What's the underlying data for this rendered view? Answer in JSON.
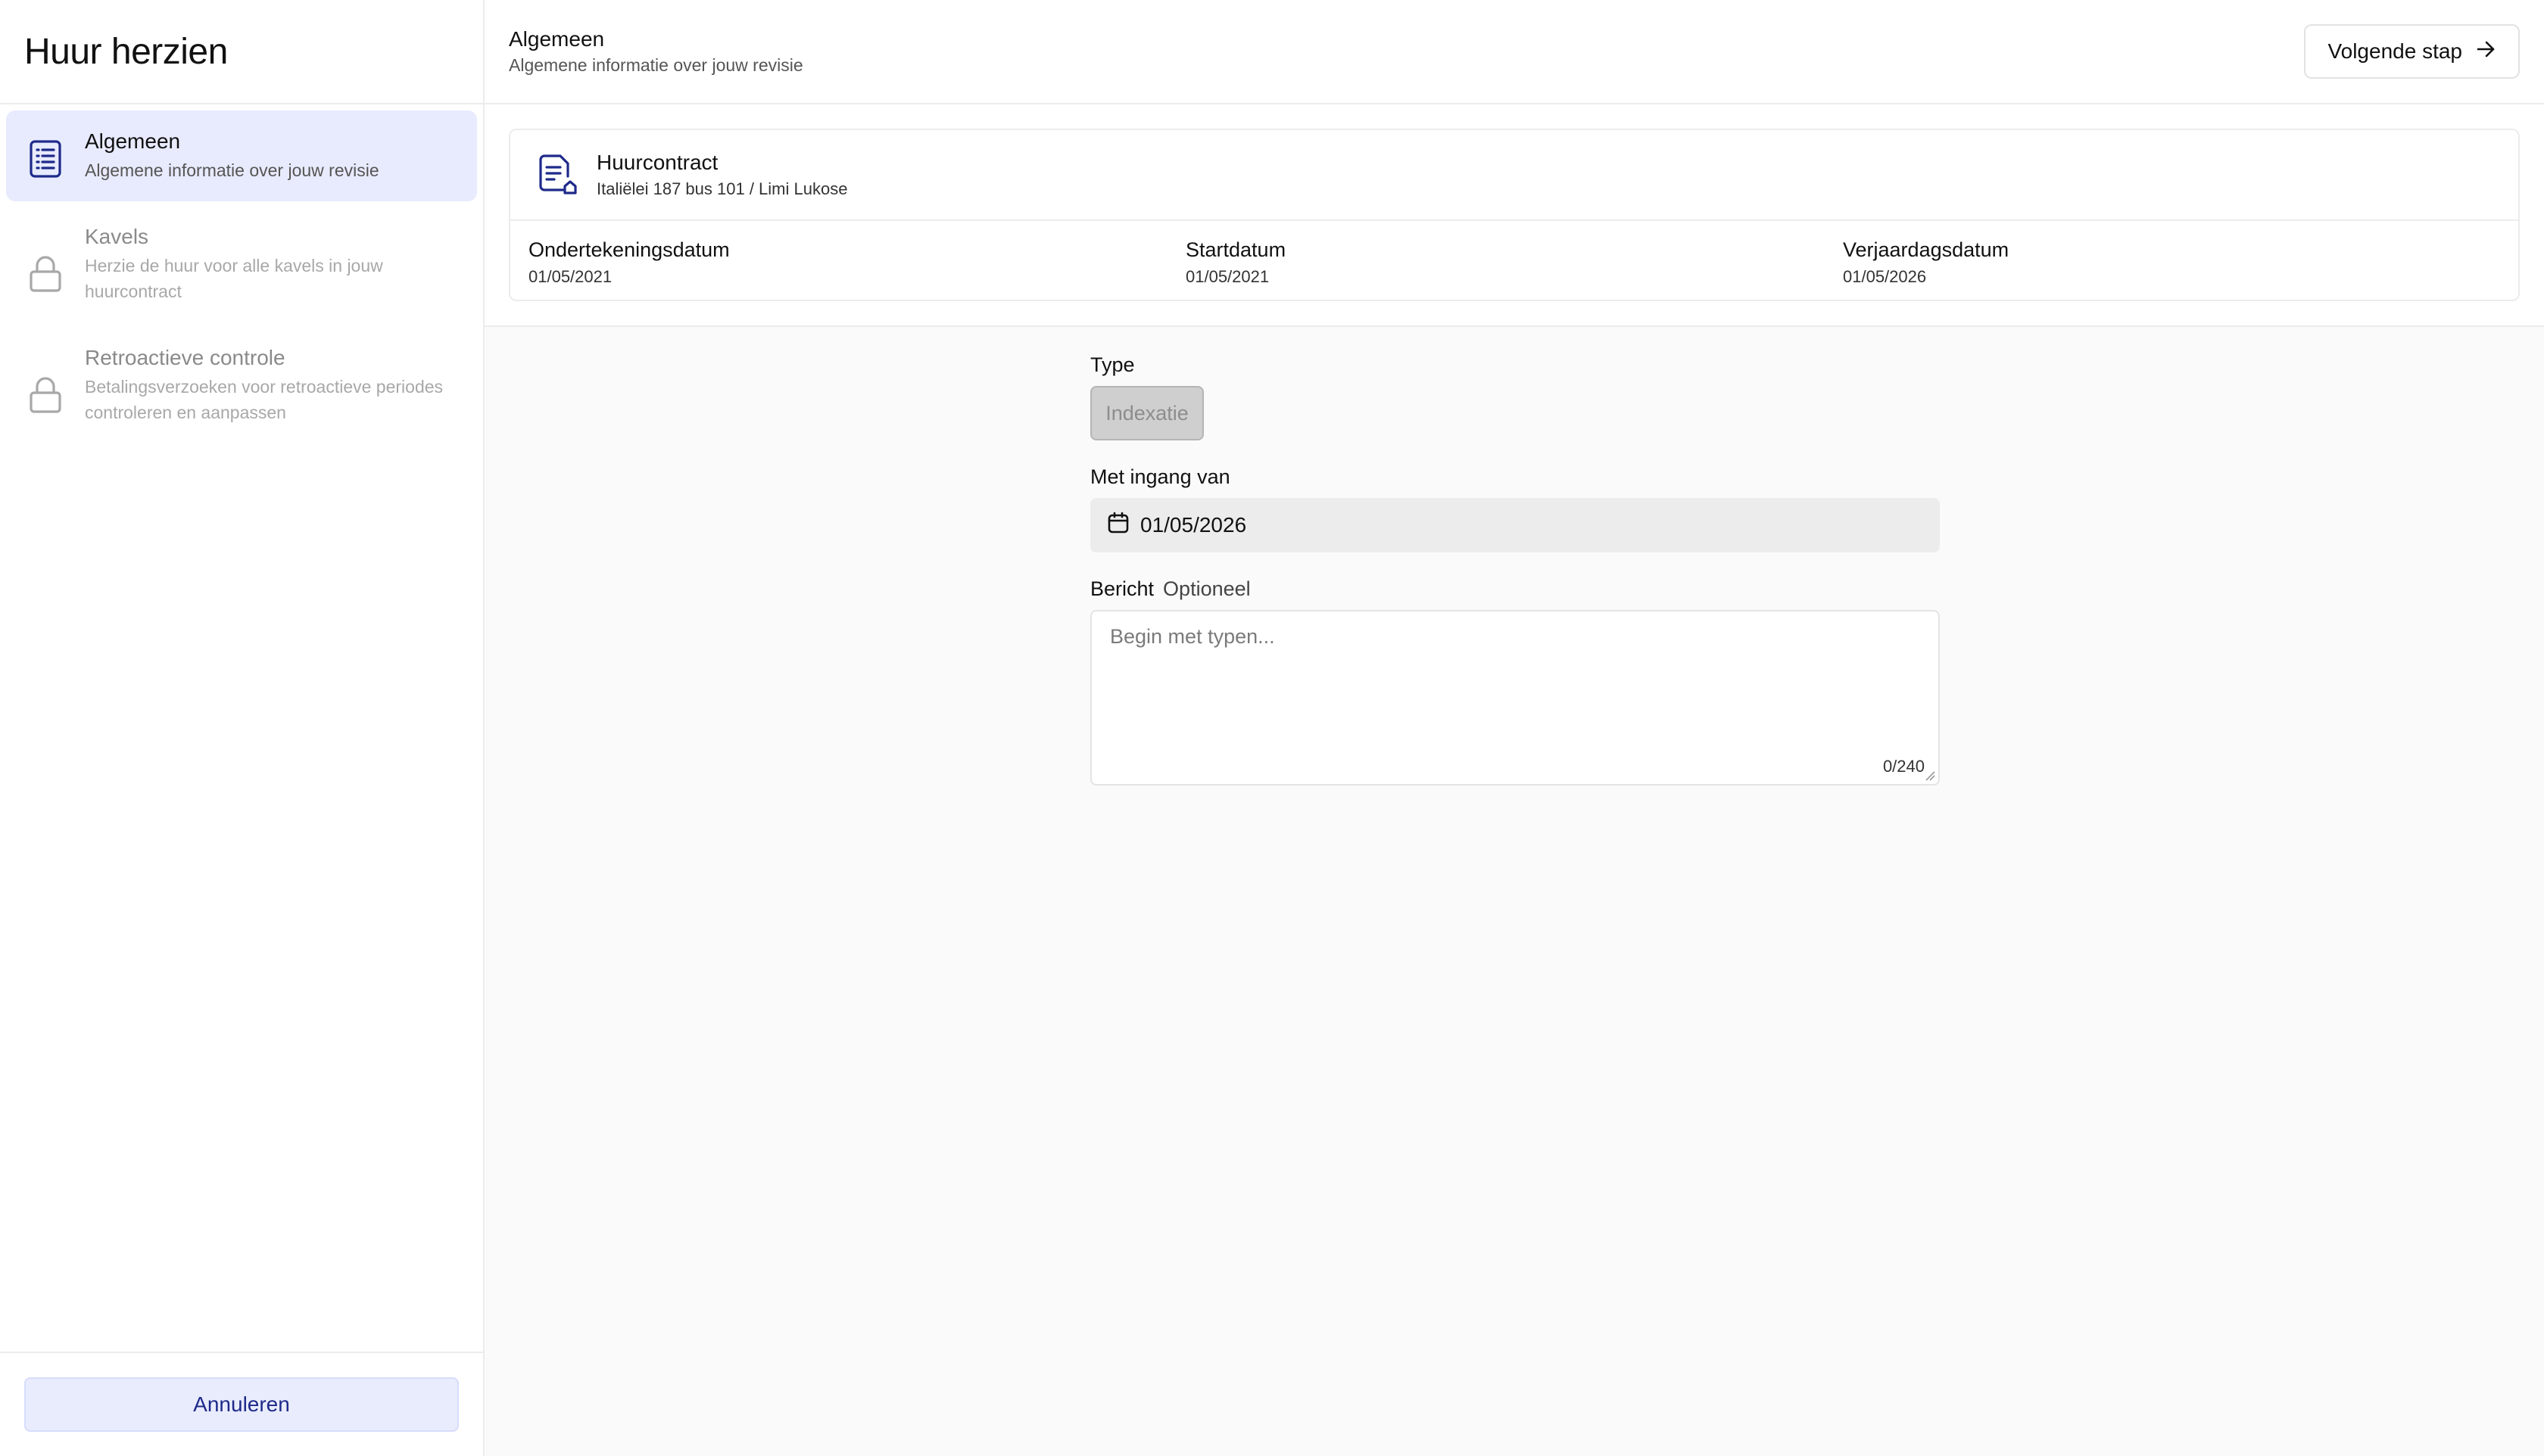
{
  "sidebar": {
    "title": "Huur herzien",
    "steps": [
      {
        "title": "Algemeen",
        "description": "Algemene informatie over jouw revisie",
        "icon": "list-document-icon",
        "state": "active"
      },
      {
        "title": "Kavels",
        "description": "Herzie de huur voor alle kavels in jouw huurcontract",
        "icon": "lock-icon",
        "state": "locked"
      },
      {
        "title": "Retroactieve controle",
        "description": "Betalingsverzoeken voor retroactieve periodes controleren en aanpassen",
        "icon": "lock-icon",
        "state": "locked"
      }
    ],
    "cancel_label": "Annuleren"
  },
  "header": {
    "title": "Algemeen",
    "subtitle": "Algemene informatie over jouw revisie",
    "next_label": "Volgende stap",
    "next_icon": "arrow-right-icon"
  },
  "contract": {
    "icon": "contract-document-icon",
    "title": "Huurcontract",
    "address": "Italiëlei 187 bus 101 / Limi Lukose",
    "dates": [
      {
        "label": "Ondertekeningsdatum",
        "value": "01/05/2021"
      },
      {
        "label": "Startdatum",
        "value": "01/05/2021"
      },
      {
        "label": "Verjaardagsdatum",
        "value": "01/05/2026"
      }
    ]
  },
  "form": {
    "type_label": "Type",
    "type_value": "Indexatie",
    "effective_label": "Met ingang van",
    "effective_value": "01/05/2026",
    "effective_icon": "calendar-icon",
    "message_label": "Bericht",
    "message_optional": "Optioneel",
    "message_placeholder": "Begin met typen...",
    "message_counter": "0/240"
  },
  "colors": {
    "accent": "#1e2a8a",
    "active_step_bg": "#e8ebfd",
    "muted": "#a8a8a8"
  }
}
